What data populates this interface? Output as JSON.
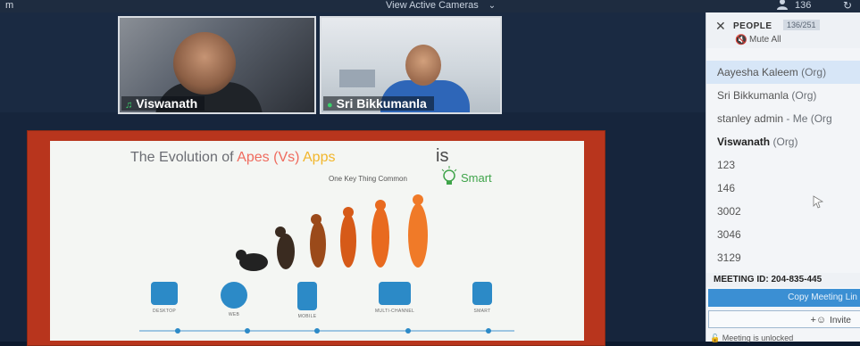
{
  "topbar": {
    "left_text": "m",
    "center_text": "View Active Cameras",
    "user_count": "136",
    "icons": [
      "chevron-down-icon",
      "user-icon",
      "refresh-icon"
    ]
  },
  "cameras": [
    {
      "name": "Viswanath",
      "mic": "active"
    },
    {
      "name": "Sri Bikkumanla",
      "mic": "active"
    }
  ],
  "slide": {
    "title_part1": "The Evolution of ",
    "title_apes": "Apes",
    "title_vs": "(Vs)",
    "title_apps": "Apps",
    "title_is": "is",
    "subtitle": "One Key Thing Common",
    "smart": "Smart",
    "icons": [
      {
        "label": "DESKTOP",
        "icon": "desktop-icon"
      },
      {
        "label": "WEB",
        "icon": "globe-icon"
      },
      {
        "label": "MOBILE",
        "icon": "mobile-icon"
      },
      {
        "label": "MULTI-CHANNEL",
        "icon": "multichannel-icon"
      },
      {
        "label": "SMART",
        "icon": "smartwatch-icon"
      }
    ]
  },
  "people_panel": {
    "title": "PEOPLE",
    "count": "136/251",
    "mute_all": "Mute All",
    "participants": [
      {
        "name": "Aayesha Kaleem",
        "tag": "(Org)"
      },
      {
        "name": "Sri Bikkumanla",
        "tag": "(Org)"
      },
      {
        "name": "stanley admin",
        "tag": "- Me (Org"
      },
      {
        "name": "Viswanath",
        "tag": "(Org)"
      },
      {
        "name": "123",
        "tag": ""
      },
      {
        "name": "146",
        "tag": ""
      },
      {
        "name": "3002",
        "tag": ""
      },
      {
        "name": "3046",
        "tag": ""
      },
      {
        "name": "3129",
        "tag": ""
      }
    ],
    "meeting_id": "MEETING ID: 204-835-445",
    "copy_button": "Copy Meeting Lin",
    "invite_button": "Invite",
    "lock_status": "Meeting is unlocked"
  },
  "colors": {
    "panel_selected": "#d7e6f7",
    "copy_button": "#3b8fd3",
    "mic_active": "#39d26a",
    "slide_border": "#b8351d"
  }
}
